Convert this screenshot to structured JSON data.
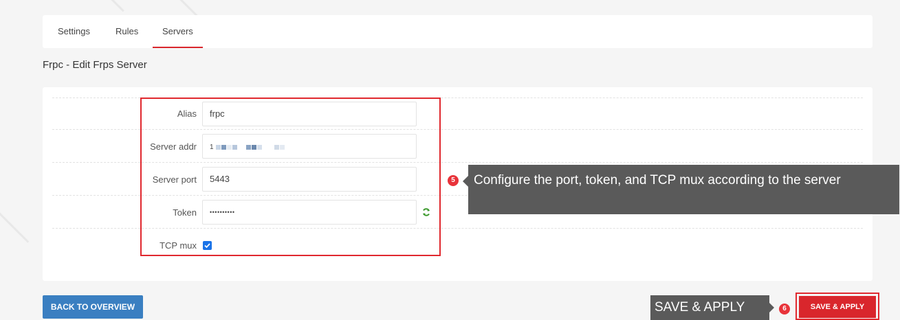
{
  "tabs": [
    {
      "label": "Settings"
    },
    {
      "label": "Rules"
    },
    {
      "label": "Servers"
    }
  ],
  "page_title": "Frpc - Edit Frps Server",
  "form": {
    "alias": {
      "label": "Alias",
      "value": "frpc"
    },
    "server_addr": {
      "label": "Server addr",
      "value": "1"
    },
    "server_port": {
      "label": "Server port",
      "value": "5443"
    },
    "token": {
      "label": "Token",
      "value": "••••••••••"
    },
    "tcp_mux": {
      "label": "TCP mux",
      "checked": true
    }
  },
  "annotations": {
    "step5_number": "5",
    "step5_text": "Configure the port, token, and TCP mux according to the server",
    "step6_number": "6",
    "step6_text": "SAVE & APPLY"
  },
  "buttons": {
    "back_label": "BACK TO OVERVIEW",
    "save_label": "SAVE & APPLY"
  },
  "colors": {
    "accent_red": "#d9262c",
    "primary_blue": "#3a7fc1",
    "checkbox_blue": "#1a73e8",
    "callout_gray": "#5a5a5a"
  },
  "icons": {
    "refresh": "refresh-icon",
    "check": "check-icon"
  }
}
